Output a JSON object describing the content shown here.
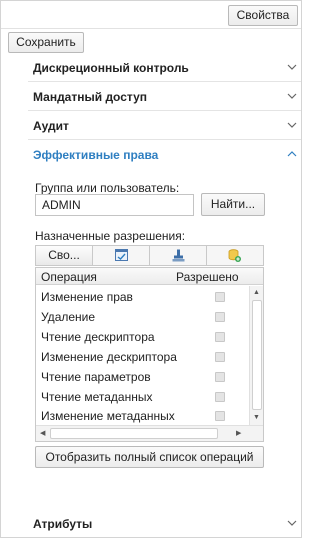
{
  "toolbar": {
    "properties_label": "Свойства",
    "save_label": "Сохранить"
  },
  "sections": [
    {
      "title": "Дискреционный контроль",
      "expanded": false
    },
    {
      "title": "Мандатный доступ",
      "expanded": false
    },
    {
      "title": "Аудит",
      "expanded": false
    },
    {
      "title": "Эффективные права",
      "expanded": true
    },
    {
      "title": "Атрибуты",
      "expanded": false
    }
  ],
  "effective_rights": {
    "group_label": "Группа или пользователь:",
    "user_value": "ADMIN",
    "find_label": "Найти...",
    "assigned_label": "Назначенные разрешения:",
    "tabs": [
      {
        "label": "Сво...",
        "icon": ""
      },
      {
        "label": "",
        "icon": "object-check-icon"
      },
      {
        "label": "",
        "icon": "stamp-icon"
      },
      {
        "label": "",
        "icon": "database-add-icon"
      }
    ],
    "columns": {
      "operation": "Операция",
      "allowed": "Разрешено"
    },
    "rows": [
      {
        "operation": "Изменение прав",
        "allowed": false
      },
      {
        "operation": "Удаление",
        "allowed": false
      },
      {
        "operation": "Чтение дескриптора",
        "allowed": false
      },
      {
        "operation": "Изменение дескриптора",
        "allowed": false
      },
      {
        "operation": "Чтение параметров",
        "allowed": false
      },
      {
        "operation": "Чтение метаданных",
        "allowed": false
      },
      {
        "operation": "Изменение метаданных",
        "allowed": false
      }
    ],
    "full_list_label": "Отобразить полный список операций"
  },
  "colors": {
    "accent": "#2f7fc1",
    "border": "#c9c9c9"
  }
}
